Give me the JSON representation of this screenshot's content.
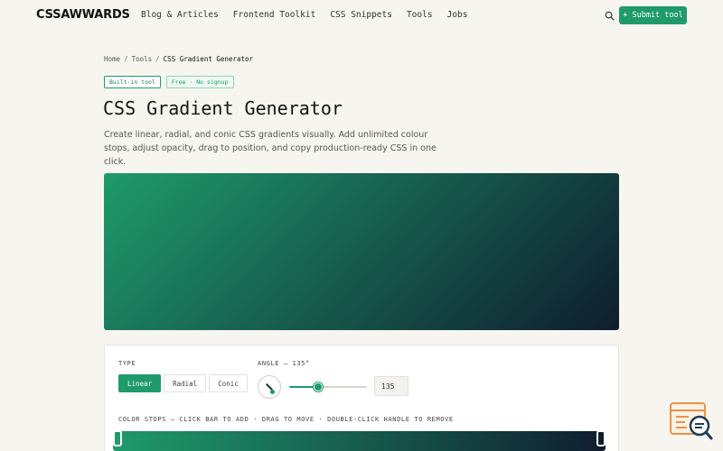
{
  "header": {
    "logo": "CSSAWWARDS",
    "nav": [
      "Blog & Articles",
      "Frontend Toolkit",
      "CSS Snippets",
      "Tools",
      "Jobs"
    ],
    "submit_label": "+ Submit tool"
  },
  "breadcrumb": {
    "home": "Home",
    "tools": "Tools",
    "current": "CSS Gradient Generator",
    "separator": "/"
  },
  "badges": {
    "primary": "Built-in tool",
    "secondary": "Free · No signup"
  },
  "page": {
    "title": "CSS Gradient Generator",
    "description": "Create linear, radial, and conic CSS gradients visually. Add unlimited colour stops, adjust opacity, drag to position, and copy production-ready CSS in one click."
  },
  "controls": {
    "type_label": "TYPE",
    "types": [
      "Linear",
      "Radial",
      "Conic"
    ],
    "active_type": "Linear",
    "angle_label": "ANGLE — 135°",
    "angle_value": "135",
    "angle_fraction": 0.375,
    "stops_label": "COLOR STOPS — CLICK BAR TO ADD · DRAG TO MOVE · DOUBLE-CLICK HANDLE TO REMOVE"
  },
  "gradient": {
    "start_color": "#1f9a6b",
    "end_color": "#0f1d2e",
    "angle_deg": 135
  },
  "stops": [
    {
      "color": "#1f9a6b",
      "position": 0
    },
    {
      "color": "#0f1d2e",
      "position": 100
    }
  ],
  "colors": {
    "accent": "#1f9a6b",
    "background": "#f6f5f0"
  },
  "icons": {
    "search": "search-icon",
    "feedback": "feedback-widget-icon"
  }
}
